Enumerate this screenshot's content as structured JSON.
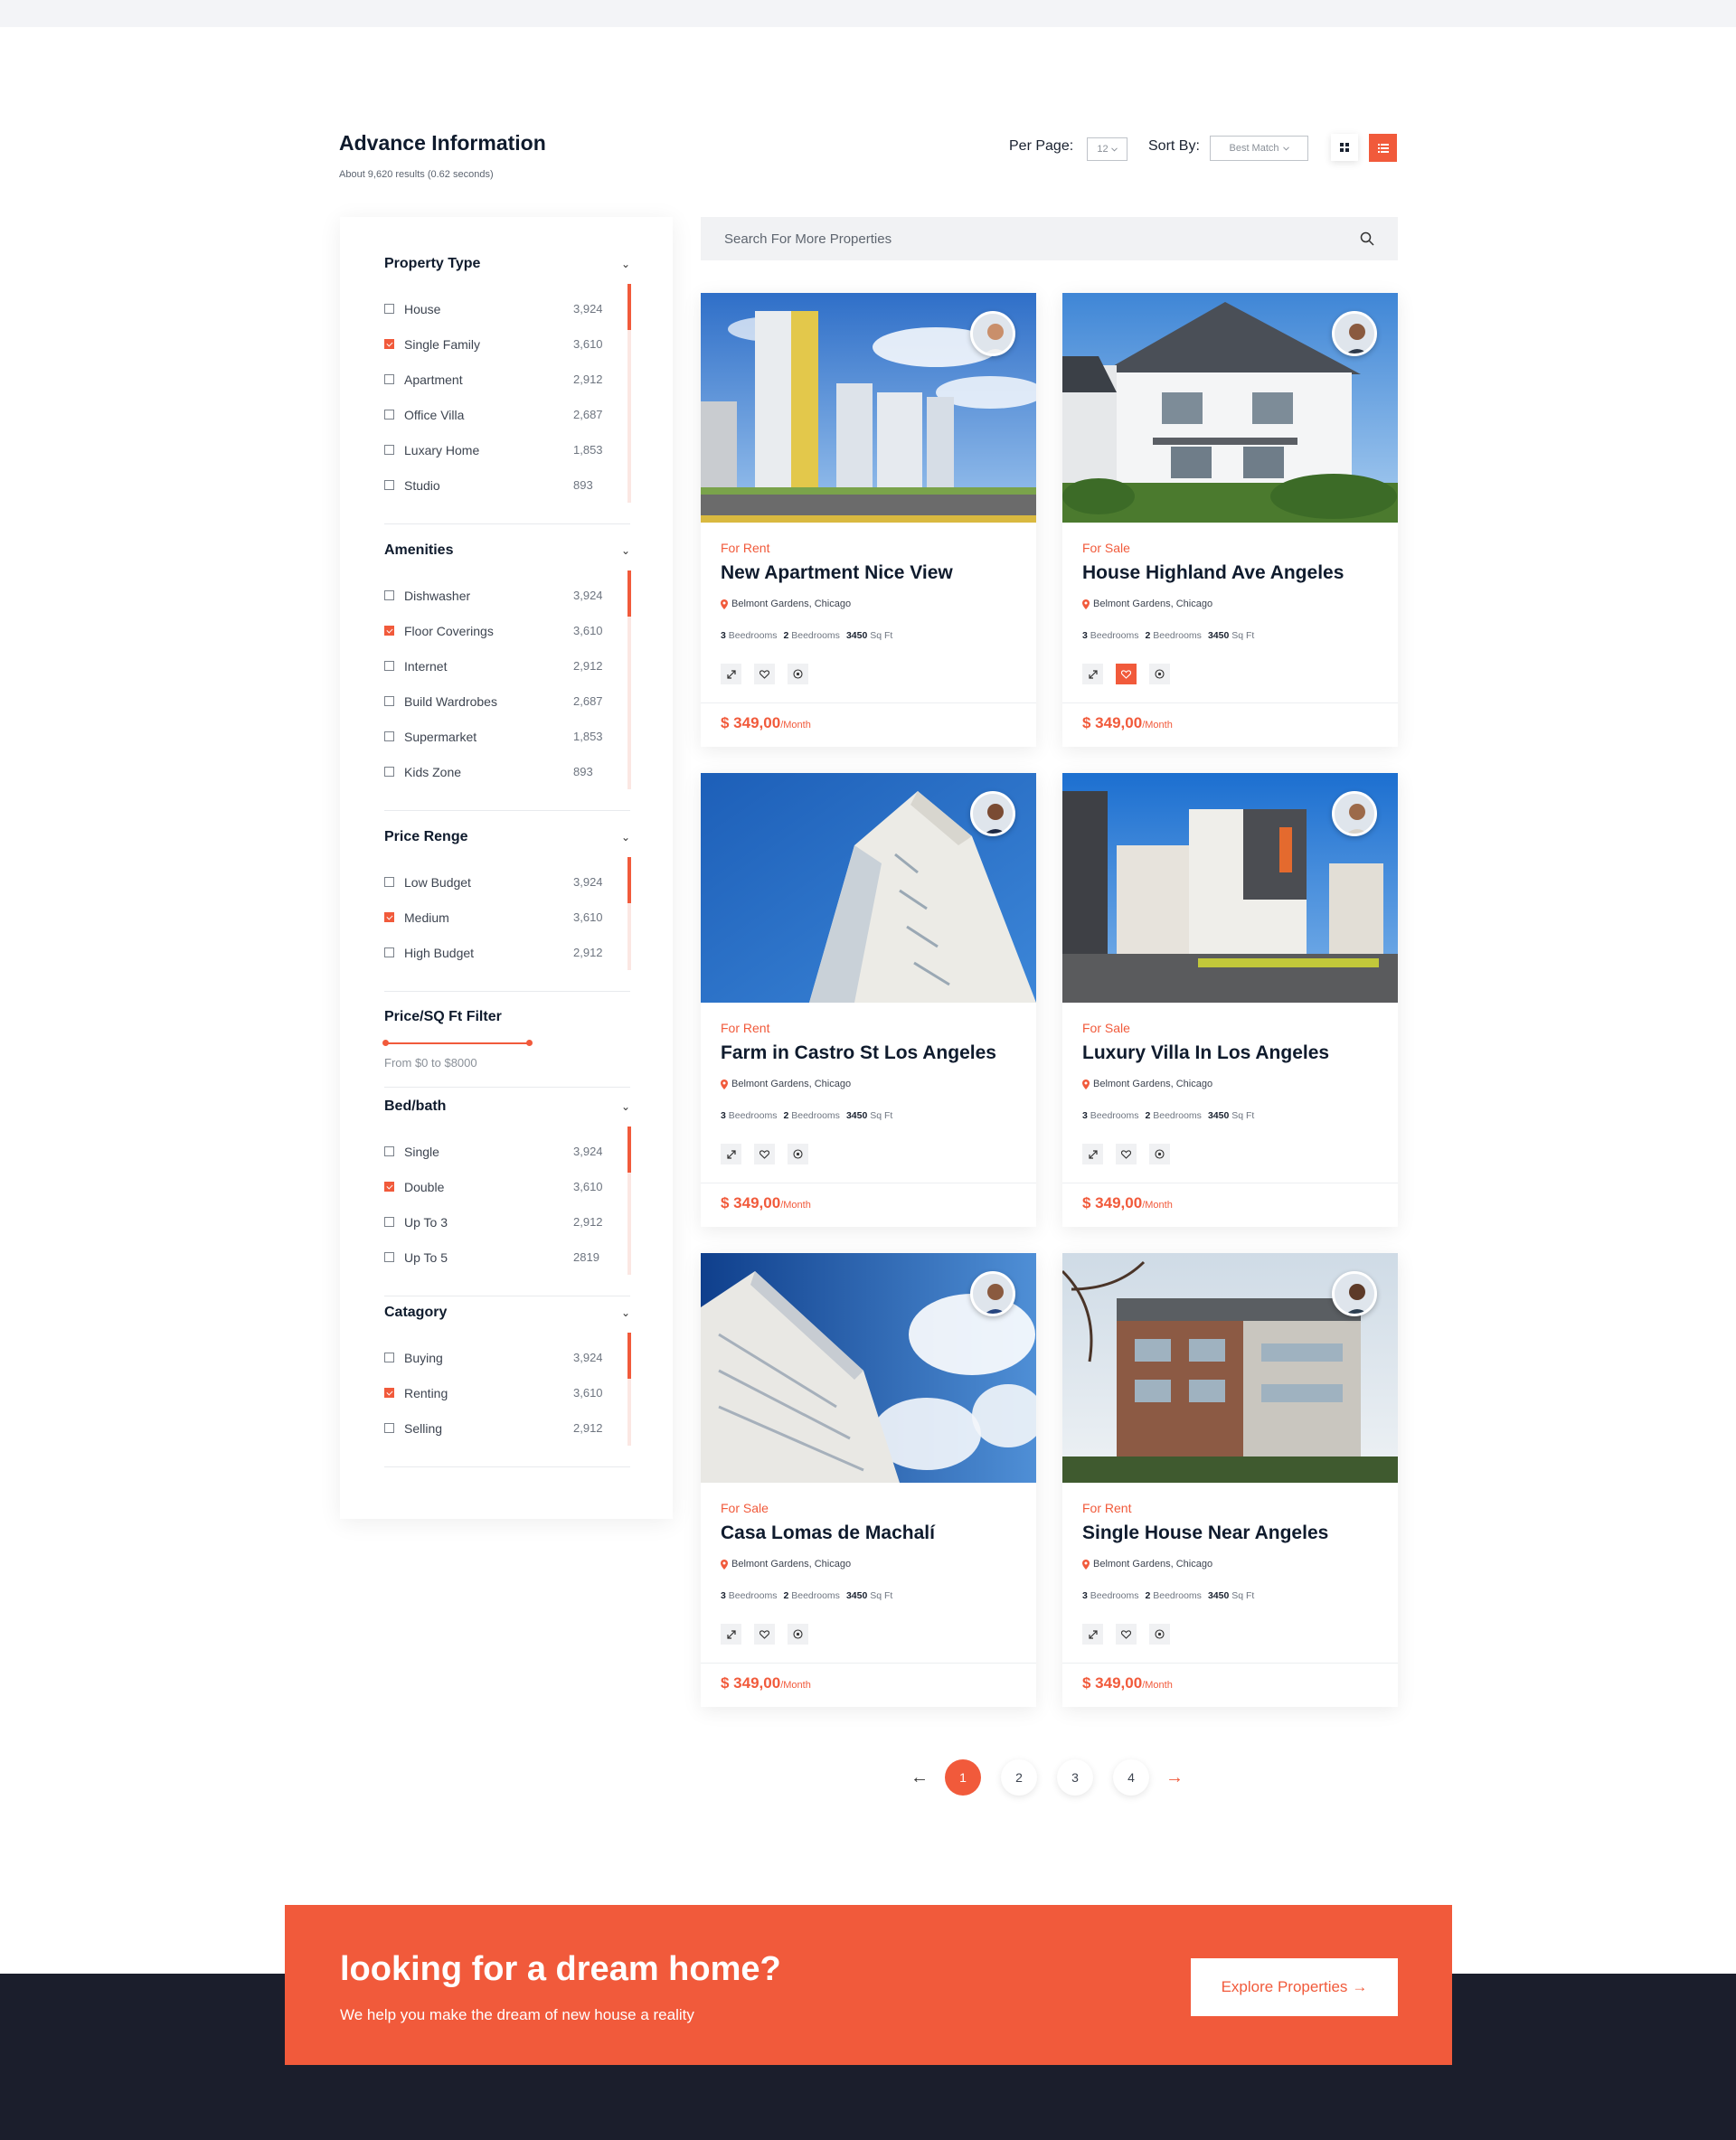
{
  "header": {
    "title": "Advance Information",
    "results": "About 9,620 results (0.62 seconds)",
    "per_page_label": "Per Page:",
    "per_page_value": "12",
    "sort_by_label": "Sort By:",
    "sort_by_value": "Best Match"
  },
  "search": {
    "placeholder": "Search For More Properties"
  },
  "filters": [
    {
      "title": "Property Type",
      "items": [
        {
          "label": "House",
          "count": "3,924",
          "checked": false
        },
        {
          "label": "Single Family",
          "count": "3,610",
          "checked": true
        },
        {
          "label": "Apartment",
          "count": "2,912",
          "checked": false
        },
        {
          "label": "Office Villa",
          "count": "2,687",
          "checked": false
        },
        {
          "label": "Luxary Home",
          "count": "1,853",
          "checked": false
        },
        {
          "label": "Studio",
          "count": "893",
          "checked": false
        }
      ]
    },
    {
      "title": "Amenities",
      "items": [
        {
          "label": "Dishwasher",
          "count": "3,924",
          "checked": false
        },
        {
          "label": "Floor Coverings",
          "count": "3,610",
          "checked": true
        },
        {
          "label": "Internet",
          "count": "2,912",
          "checked": false
        },
        {
          "label": "Build Wardrobes",
          "count": "2,687",
          "checked": false
        },
        {
          "label": "Supermarket",
          "count": "1,853",
          "checked": false
        },
        {
          "label": "Kids Zone",
          "count": "893",
          "checked": false
        }
      ]
    },
    {
      "title": "Price Renge",
      "items": [
        {
          "label": "Low Budget",
          "count": "3,924",
          "checked": false
        },
        {
          "label": "Medium",
          "count": "3,610",
          "checked": true
        },
        {
          "label": "High Budget",
          "count": "2,912",
          "checked": false
        }
      ]
    },
    {
      "title": "Bed/bath",
      "items": [
        {
          "label": "Single",
          "count": "3,924",
          "checked": false
        },
        {
          "label": "Double",
          "count": "3,610",
          "checked": true
        },
        {
          "label": "Up To 3",
          "count": "2,912",
          "checked": false
        },
        {
          "label": "Up To 5",
          "count": "2819",
          "checked": false
        }
      ]
    },
    {
      "title": "Catagory",
      "items": [
        {
          "label": "Buying",
          "count": "3,924",
          "checked": false
        },
        {
          "label": "Renting",
          "count": "3,610",
          "checked": true
        },
        {
          "label": "Selling",
          "count": "2,912",
          "checked": false
        }
      ]
    }
  ],
  "price_filter": {
    "title": "Price/SQ Ft Filter",
    "range_text": "From $0 to $8000"
  },
  "listings": [
    {
      "status": "For Rent",
      "title": "New Apartment Nice View",
      "location": "Belmont Gardens, Chicago",
      "beds": "3",
      "beds_label": "Beedrooms",
      "baths": "2",
      "baths_label": "Beedrooms",
      "area": "3450",
      "area_unit": "Sq Ft",
      "price": "$ 349,00",
      "price_unit": "/Month",
      "favorite": false
    },
    {
      "status": "For Sale",
      "title": "House Highland Ave Angeles",
      "location": "Belmont Gardens, Chicago",
      "beds": "3",
      "beds_label": "Beedrooms",
      "baths": "2",
      "baths_label": "Beedrooms",
      "area": "3450",
      "area_unit": "Sq Ft",
      "price": "$ 349,00",
      "price_unit": "/Month",
      "favorite": true
    },
    {
      "status": "For Rent",
      "title": "Farm in Castro St Los Angeles",
      "location": "Belmont Gardens, Chicago",
      "beds": "3",
      "beds_label": "Beedrooms",
      "baths": "2",
      "baths_label": "Beedrooms",
      "area": "3450",
      "area_unit": "Sq Ft",
      "price": "$ 349,00",
      "price_unit": "/Month",
      "favorite": false
    },
    {
      "status": "For Sale",
      "title": "Luxury Villa In Los Angeles",
      "location": "Belmont Gardens, Chicago",
      "beds": "3",
      "beds_label": "Beedrooms",
      "baths": "2",
      "baths_label": "Beedrooms",
      "area": "3450",
      "area_unit": "Sq Ft",
      "price": "$ 349,00",
      "price_unit": "/Month",
      "favorite": false
    },
    {
      "status": "For Sale",
      "title": "Casa Lomas de Machalí",
      "location": "Belmont Gardens, Chicago",
      "beds": "3",
      "beds_label": "Beedrooms",
      "baths": "2",
      "baths_label": "Beedrooms",
      "area": "3450",
      "area_unit": "Sq Ft",
      "price": "$ 349,00",
      "price_unit": "/Month",
      "favorite": false
    },
    {
      "status": "For Rent",
      "title": "Single House Near Angeles",
      "location": "Belmont Gardens, Chicago",
      "beds": "3",
      "beds_label": "Beedrooms",
      "baths": "2",
      "baths_label": "Beedrooms",
      "area": "3450",
      "area_unit": "Sq Ft",
      "price": "$ 349,00",
      "price_unit": "/Month",
      "favorite": false
    }
  ],
  "pagination": {
    "pages": [
      "1",
      "2",
      "3",
      "4"
    ],
    "current": "1",
    "prev": "←",
    "next": "→"
  },
  "cta": {
    "title": "looking for a dream home?",
    "subtitle": "We help you make the dream of new house a reality",
    "button": "Explore Properties",
    "button_arrow": "→"
  },
  "colors": {
    "accent": "#f15a3b",
    "dark": "#1b1e2c",
    "text": "#0f1b2d"
  }
}
